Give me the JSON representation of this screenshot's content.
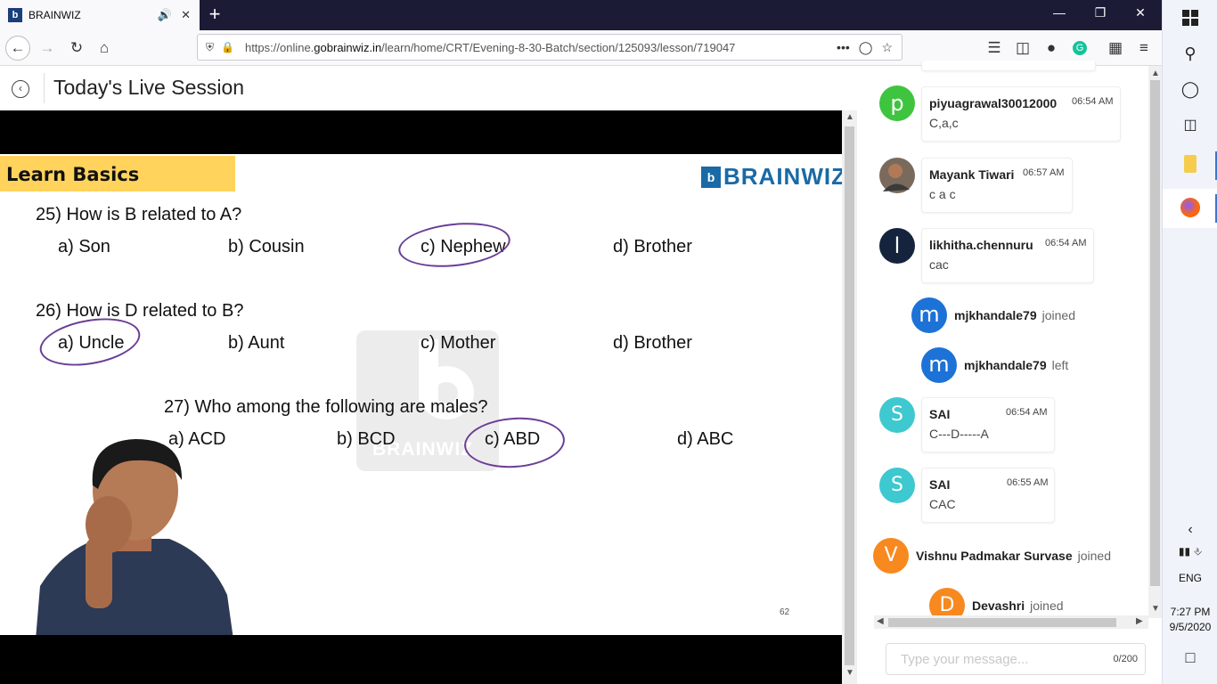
{
  "browser": {
    "tab_title": "BRAINWIZ",
    "favicon_letter": "b",
    "new_tab": "+",
    "url_prefix": "https://online.",
    "url_domain": "gobrainwiz.in",
    "url_path": "/learn/home/CRT/Evening-8-30-Batch/section/125093/lesson/719047"
  },
  "page": {
    "title": "Today's Live Session"
  },
  "slide": {
    "banner": "Learn Basics",
    "logo_letter": "b",
    "logo_text": "BRAINWIZ",
    "watermark_text": "BRAINWIZ",
    "page_number": "62",
    "questions": [
      {
        "text": "25) How is B related to A?",
        "options": [
          "a) Son",
          "b) Cousin",
          "c) Nephew",
          "d) Brother"
        ]
      },
      {
        "text": "26) How is D related to B?",
        "options": [
          "a) Uncle",
          "b) Aunt",
          "c) Mother",
          "d) Brother"
        ]
      },
      {
        "text": "27) Who among the following are males?",
        "options": [
          "a) ACD",
          "b) BCD",
          "c) ABD",
          "d) ABC"
        ]
      }
    ]
  },
  "chat": {
    "messages": [
      {
        "avatar": "p",
        "avatar_color": "#3fc43f",
        "name": "piyuagrawal30012000",
        "time": "06:54 AM",
        "text": "C,a,c"
      },
      {
        "avatar": "photo",
        "name": "Mayank Tiwari",
        "time": "06:57 AM",
        "text": "c a c"
      },
      {
        "avatar": "l",
        "avatar_color": "#15233d",
        "name": "likhitha.chennuru",
        "time": "06:54 AM",
        "text": "cac"
      },
      {
        "avatar": "S",
        "avatar_color": "#3ec8cf",
        "name": "SAI",
        "time": "06:54 AM",
        "text": "C---D-----A"
      },
      {
        "avatar": "S",
        "avatar_color": "#3ec8cf",
        "name": "SAI",
        "time": "06:55 AM",
        "text": "CAC"
      }
    ],
    "events": [
      {
        "avatar": "m",
        "avatar_color": "#1c72d6",
        "name": "mjkhandale79",
        "action": "joined"
      },
      {
        "avatar": "m",
        "avatar_color": "#1c72d6",
        "name": "mjkhandale79",
        "action": "left"
      },
      {
        "avatar": "V",
        "avatar_color": "#f7891f",
        "name": "Vishnu Padmakar Survase",
        "action": "joined"
      },
      {
        "avatar": "D",
        "avatar_color": "#f7891f",
        "name": "Devashri",
        "action": "joined"
      }
    ],
    "input_placeholder": "Type your message...",
    "char_count": "0/200"
  },
  "taskbar": {
    "language": "ENG",
    "time": "7:27 PM",
    "date": "9/5/2020"
  }
}
